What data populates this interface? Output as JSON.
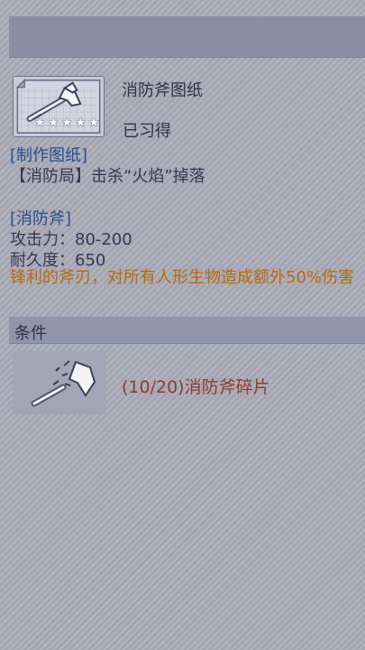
{
  "header": {},
  "item": {
    "name": "消防斧图纸",
    "status": "已习得",
    "rarity_stars": 5,
    "icon": "fire-axe-blueprint-icon"
  },
  "crafting": {
    "label": "[制作图纸]",
    "source": "【消防局】击杀“火焰”掉落"
  },
  "weapon": {
    "name": "[消防斧]",
    "attack": "攻击力：80-200",
    "durability": "耐久度：650",
    "description": "锋利的斧刃，对所有人形生物造成额外50%伤害"
  },
  "conditions": {
    "label": "条件",
    "material": {
      "text": "(10/20)消防斧碎片",
      "icon": "fire-axe-fragment-icon"
    }
  },
  "colors": {
    "background": "#a9aab7",
    "title_blue": "#2b4f86",
    "description_orange": "#b66a09",
    "material_red": "#8d3e2e"
  }
}
